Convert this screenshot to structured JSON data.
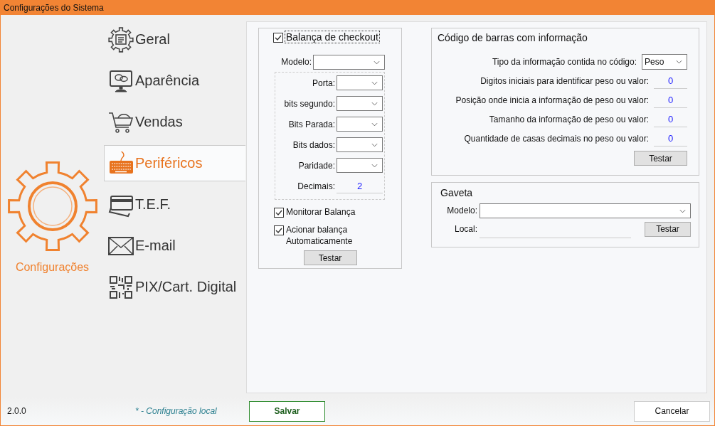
{
  "window": {
    "title": "Configurações do Sistema"
  },
  "logo": {
    "label": "Configurações"
  },
  "nav": [
    {
      "label": "Geral",
      "selected": false
    },
    {
      "label": "Aparência",
      "selected": false
    },
    {
      "label": "Vendas",
      "selected": false
    },
    {
      "label": "Periféricos",
      "selected": true
    },
    {
      "label": "T.E.F.",
      "selected": false
    },
    {
      "label": "E-mail",
      "selected": false
    },
    {
      "label": "PIX/Cart. Digital",
      "selected": false
    }
  ],
  "scale": {
    "enable": {
      "label": "Balança de checkout",
      "checked": true
    },
    "model": {
      "label": "Modelo:"
    },
    "serial": [
      {
        "kind": "select",
        "label": "Porta:"
      },
      {
        "kind": "select",
        "label": "bits segundo:"
      },
      {
        "kind": "select",
        "label": "Bits Parada:"
      },
      {
        "kind": "select",
        "label": "Bits dados:"
      },
      {
        "kind": "select",
        "label": "Paridade:"
      },
      {
        "kind": "input",
        "label": "Decimais:",
        "value": "2"
      }
    ],
    "options": [
      {
        "label": "Monitorar Balança",
        "checked": true
      },
      {
        "label": "Acionar balança Automaticamente",
        "checked": true
      }
    ],
    "button": "Testar"
  },
  "barcode": {
    "title": "Código de barras com informação",
    "type": {
      "label": "Tipo da informação contida no código:",
      "value": "Peso"
    },
    "fields": [
      {
        "label": "Digitos iniciais para identificar peso ou valor:",
        "value": "0"
      },
      {
        "label": "Posição onde inicia a informação de peso ou valor:",
        "value": "0"
      },
      {
        "label": "Tamanho da informação de peso ou valor:",
        "value": "0"
      },
      {
        "label": "Quantidade de casas decimais no peso ou valor:",
        "value": "0"
      }
    ],
    "button": "Testar"
  },
  "drawer": {
    "title": "Gaveta",
    "model": {
      "label": "Modelo:"
    },
    "local": {
      "label": "Local:"
    },
    "button": "Testar"
  },
  "footer": {
    "version": "2.0.0",
    "note": "* - Configuração local",
    "save": "Salvar",
    "cancel": "Cancelar"
  }
}
